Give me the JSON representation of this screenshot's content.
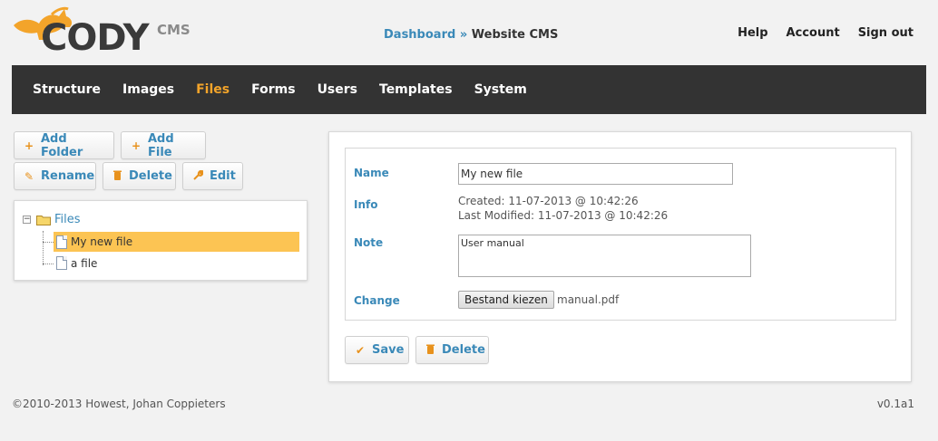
{
  "brand": {
    "name": "CODY",
    "suffix": "CMS",
    "accent": "#f3a42a"
  },
  "breadcrumb": {
    "link": "Dashboard",
    "separator": "»",
    "current": "Website CMS"
  },
  "toplinks": [
    "Help",
    "Account",
    "Sign out"
  ],
  "nav": {
    "items": [
      "Structure",
      "Images",
      "Files",
      "Forms",
      "Users",
      "Templates",
      "System"
    ],
    "active": "Files"
  },
  "toolbar": {
    "add_folder": "Add Folder",
    "add_file": "Add File",
    "rename": "Rename",
    "delete": "Delete",
    "edit": "Edit"
  },
  "tree": {
    "root": "Files",
    "items": [
      {
        "label": "My new file",
        "selected": true
      },
      {
        "label": "a file",
        "selected": false
      }
    ]
  },
  "form": {
    "name_label": "Name",
    "name_value": "My new file",
    "info_label": "Info",
    "created": "Created: 11-07-2013 @ 10:42:26",
    "modified": "Last Modified: 11-07-2013 @ 10:42:26",
    "note_label": "Note",
    "note_value": "User manual",
    "change_label": "Change",
    "choose_file_button": "Bestand kiezen",
    "chosen_file": "manual.pdf"
  },
  "actions": {
    "save": "Save",
    "delete": "Delete"
  },
  "footer": {
    "copyright": "©2010-2013 Howest, Johan Coppieters",
    "version": "v0.1a1"
  }
}
